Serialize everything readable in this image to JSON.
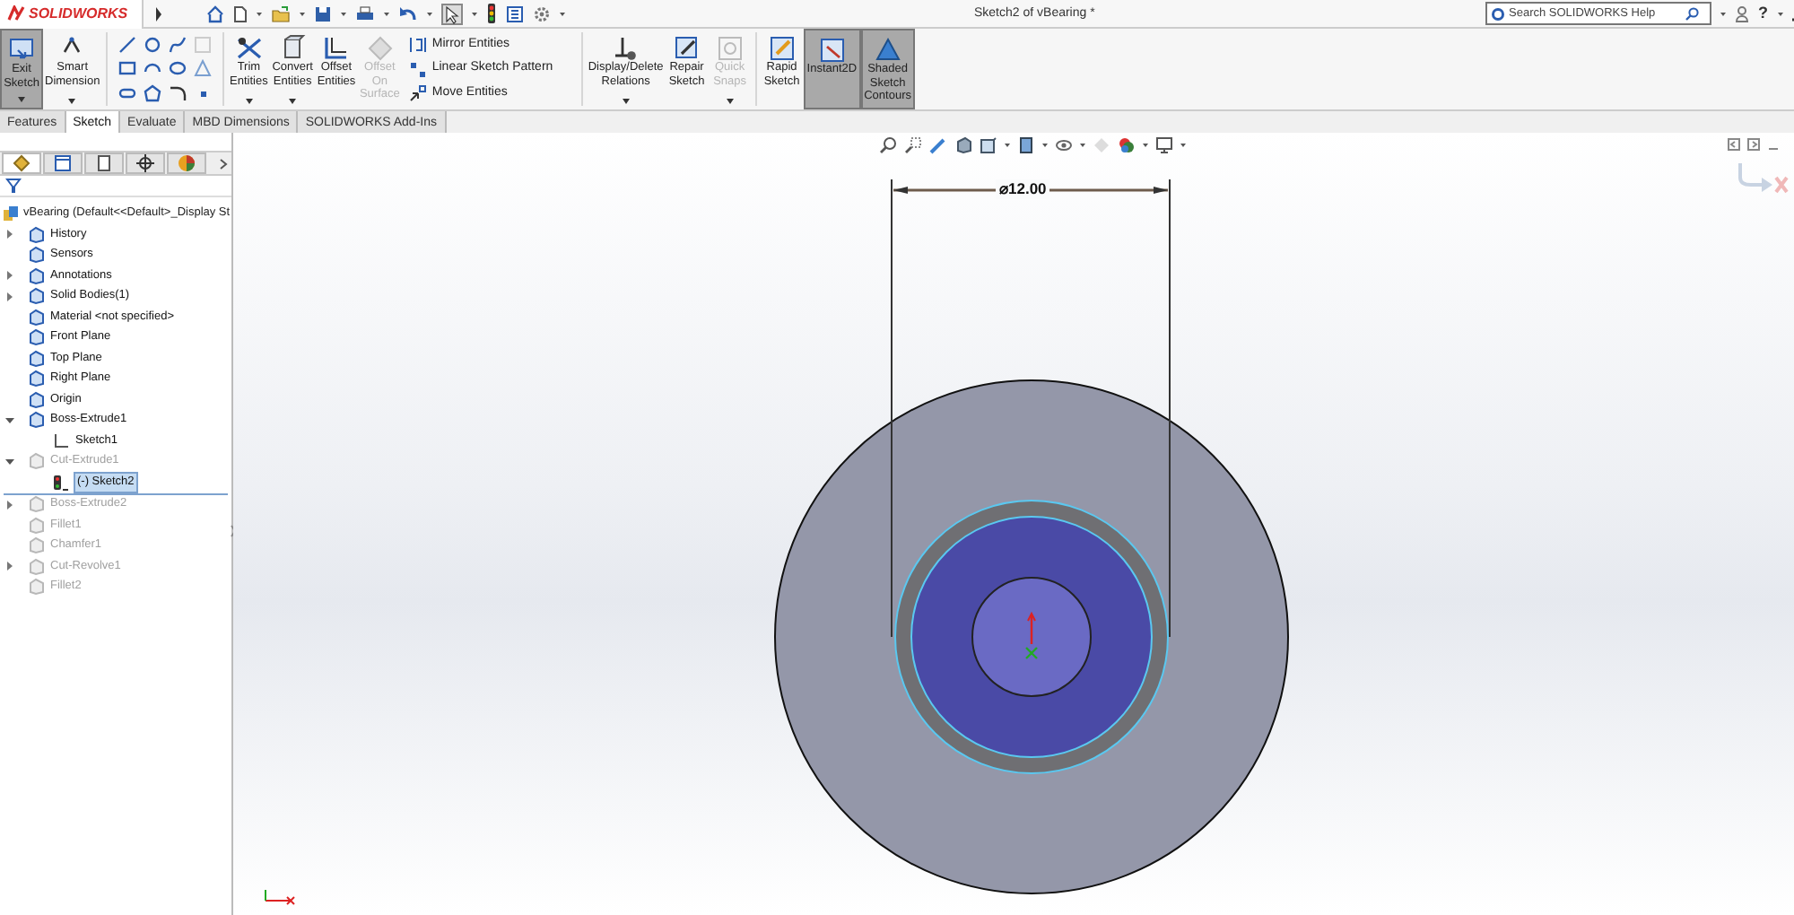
{
  "app": {
    "logo": "SOLIDWORKS",
    "title": "Sketch2 of vBearing *",
    "help_search": {
      "placeholder": "Search SOLIDWORKS Help"
    },
    "help_label": "?"
  },
  "ribbon": [
    {
      "kind": "large",
      "label": "Exit Sketch",
      "selected": true,
      "disabled": false,
      "caret": true
    },
    {
      "kind": "large",
      "label": "Smart Dimension",
      "selected": false,
      "disabled": false,
      "caret": true
    },
    {
      "kind": "tools"
    },
    {
      "kind": "large",
      "label": "Trim Entities",
      "selected": false,
      "disabled": false,
      "caret": true
    },
    {
      "kind": "large",
      "label": "Convert Entities",
      "selected": false,
      "disabled": false,
      "caret": true
    },
    {
      "kind": "large",
      "label": "Offset Entities",
      "selected": false,
      "disabled": false,
      "caret": false
    },
    {
      "kind": "large",
      "label": "Offset On Surface",
      "selected": false,
      "disabled": true,
      "caret": false
    },
    {
      "kind": "list",
      "items": [
        "Mirror Entities",
        "Linear Sketch Pattern",
        "Move Entities"
      ]
    },
    {
      "kind": "large",
      "label": "Display/Delete Relations",
      "selected": false,
      "disabled": false,
      "caret": true
    },
    {
      "kind": "large",
      "label": "Repair Sketch",
      "selected": false,
      "disabled": false,
      "caret": false
    },
    {
      "kind": "large",
      "label": "Quick Snaps",
      "selected": false,
      "disabled": true,
      "caret": true
    },
    {
      "kind": "large",
      "label": "Rapid Sketch",
      "selected": false,
      "disabled": false,
      "caret": false
    },
    {
      "kind": "large",
      "label": "Instant2D",
      "selected": true,
      "disabled": false,
      "caret": false
    },
    {
      "kind": "large",
      "label": "Shaded Sketch Contours",
      "selected": true,
      "disabled": false,
      "caret": false
    }
  ],
  "command_tabs": [
    {
      "label": "Features",
      "selected": false
    },
    {
      "label": "Sketch",
      "selected": true
    },
    {
      "label": "Evaluate",
      "selected": false
    },
    {
      "label": "MBD Dimensions",
      "selected": false
    },
    {
      "label": "SOLIDWORKS Add-Ins",
      "selected": false
    }
  ],
  "panel_tabs": [
    {
      "selected": true
    },
    {
      "selected": false
    },
    {
      "selected": false
    },
    {
      "selected": false
    },
    {
      "selected": false
    }
  ],
  "tree": {
    "root": "vBearing  (Default<<Default>_Display St",
    "items": [
      {
        "label": "History",
        "expanded": false,
        "suppressed": false,
        "selected": false
      },
      {
        "label": "Sensors",
        "suppressed": false,
        "selected": false
      },
      {
        "label": "Annotations",
        "expanded": false,
        "suppressed": false,
        "selected": false
      },
      {
        "label": "Solid Bodies(1)",
        "expanded": false,
        "suppressed": false,
        "selected": false
      },
      {
        "label": "Material <not specified>",
        "suppressed": false,
        "selected": false
      },
      {
        "label": "Front Plane",
        "suppressed": false,
        "selected": false
      },
      {
        "label": "Top Plane",
        "suppressed": false,
        "selected": false
      },
      {
        "label": "Right Plane",
        "suppressed": false,
        "selected": false
      },
      {
        "label": "Origin",
        "suppressed": false,
        "selected": false
      },
      {
        "label": "Boss-Extrude1",
        "expanded": true,
        "suppressed": false,
        "selected": false,
        "children": [
          {
            "label": "Sketch1",
            "suppressed": false,
            "selected": false
          }
        ]
      },
      {
        "label": "Cut-Extrude1",
        "expanded": true,
        "suppressed": true,
        "selected": false,
        "children": [
          {
            "label": "(-) Sketch2",
            "suppressed": false,
            "selected": true
          }
        ]
      },
      {
        "label": "Boss-Extrude2",
        "expanded": false,
        "suppressed": true,
        "selected": false
      },
      {
        "label": "Fillet1",
        "suppressed": true,
        "selected": false
      },
      {
        "label": "Chamfer1",
        "suppressed": true,
        "selected": false
      },
      {
        "label": "Cut-Revolve1",
        "expanded": false,
        "suppressed": true,
        "selected": false
      },
      {
        "label": "Fillet2",
        "suppressed": true,
        "selected": false
      }
    ]
  },
  "dimension": {
    "text": "⌀12.00"
  }
}
